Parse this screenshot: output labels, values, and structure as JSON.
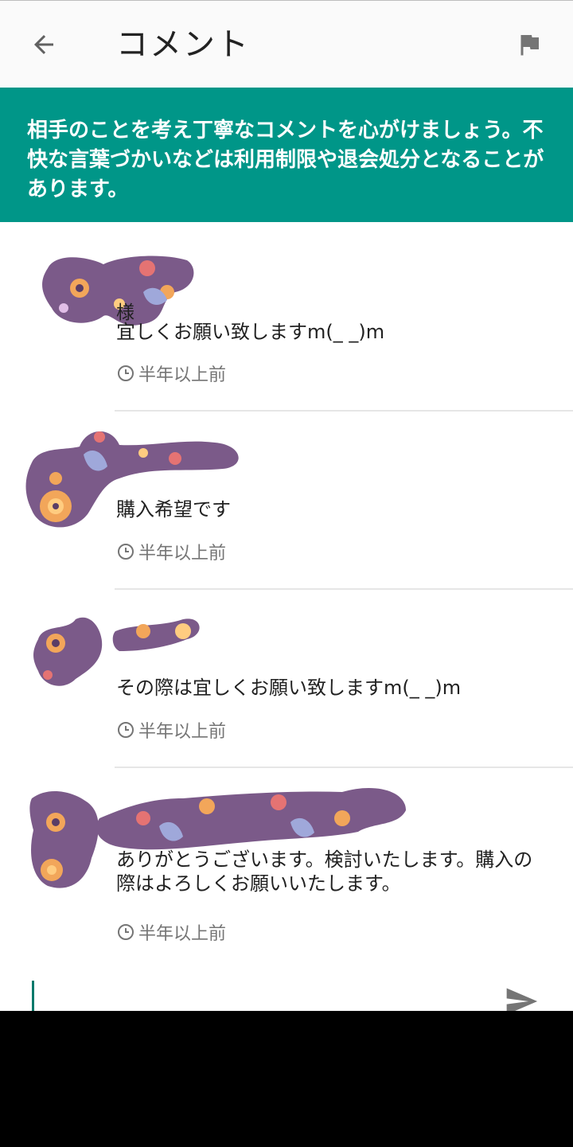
{
  "header": {
    "title": "コメント"
  },
  "notice": {
    "text": "相手のことを考え丁寧なコメントを心がけましょう。不快な言葉づかいなどは利用制限や退会処分となることがあります。"
  },
  "comments": [
    {
      "author": "様",
      "body": "宜しくお願い致しますm(_ _)m",
      "time": "半年以上前"
    },
    {
      "author": "",
      "body": "購入希望です",
      "time": "半年以上前"
    },
    {
      "author": "",
      "body": "その際は宜しくお願い致しますm(_ _)m",
      "time": "半年以上前"
    },
    {
      "author": "",
      "body": "ありがとうございます。検討いたします。購入の際はよろしくお願いいたします。",
      "time": "半年以上前"
    }
  ],
  "input": {
    "value": ""
  },
  "colors": {
    "accent": "#009688",
    "cursor": "#00796b",
    "redaction": "#7b5a89"
  },
  "icons": {
    "back": "arrow-back-icon",
    "flag": "flag-icon",
    "clock": "clock-icon",
    "send": "send-icon"
  }
}
